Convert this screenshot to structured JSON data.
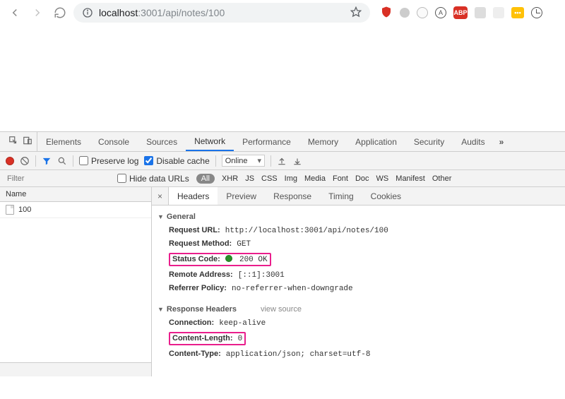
{
  "browser": {
    "url_host": "localhost",
    "url_path": ":3001/api/notes/100",
    "extensions": {
      "abp": "ABP",
      "circle_a": "A",
      "yellow": "•••"
    }
  },
  "devtools": {
    "tabs": [
      "Elements",
      "Console",
      "Sources",
      "Network",
      "Performance",
      "Memory",
      "Application",
      "Security",
      "Audits"
    ],
    "active_tab": "Network",
    "more": "»"
  },
  "network_toolbar": {
    "preserve_log": "Preserve log",
    "disable_cache": "Disable cache",
    "throttle": "Online"
  },
  "filter_row": {
    "placeholder": "Filter",
    "hide_data_urls": "Hide data URLs",
    "all_pill": "All",
    "types": [
      "XHR",
      "JS",
      "CSS",
      "Img",
      "Media",
      "Font",
      "Doc",
      "WS",
      "Manifest",
      "Other"
    ]
  },
  "request_list": {
    "header": "Name",
    "rows": [
      "100"
    ]
  },
  "detail_tabs": [
    "Headers",
    "Preview",
    "Response",
    "Timing",
    "Cookies"
  ],
  "headers": {
    "general_title": "General",
    "general": {
      "request_url_k": "Request URL:",
      "request_url_v": "http://localhost:3001/api/notes/100",
      "request_method_k": "Request Method:",
      "request_method_v": "GET",
      "status_code_k": "Status Code:",
      "status_code_v": "200 OK",
      "remote_address_k": "Remote Address:",
      "remote_address_v": "[::1]:3001",
      "referrer_policy_k": "Referrer Policy:",
      "referrer_policy_v": "no-referrer-when-downgrade"
    },
    "response_title": "Response Headers",
    "view_source": "view source",
    "response": {
      "connection_k": "Connection:",
      "connection_v": "keep-alive",
      "content_length_k": "Content-Length:",
      "content_length_v": "0",
      "content_type_k": "Content-Type:",
      "content_type_v": "application/json; charset=utf-8"
    }
  }
}
